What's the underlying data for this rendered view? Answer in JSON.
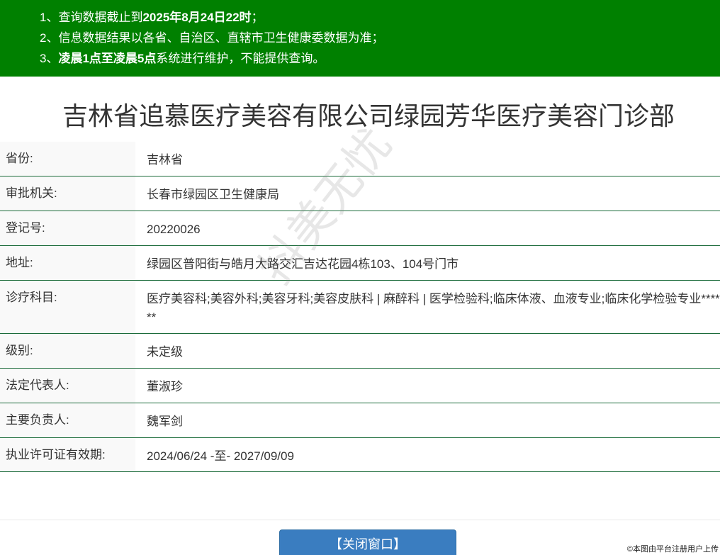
{
  "notice": {
    "line1_prefix": "1、查询数据截止到",
    "line1_bold": "2025年8月24日22时",
    "line1_suffix": "；",
    "line2": "2、信息数据结果以各省、自治区、直辖市卫生健康委数据为准；",
    "line3_prefix": "3、",
    "line3_bold": "凌晨1点至凌晨5点",
    "line3_suffix": "系统进行维护，不能提供查询。"
  },
  "title": "吉林省追慕医疗美容有限公司绿园芳华医疗美容门诊部",
  "rows": [
    {
      "label": "省份:",
      "value": "吉林省"
    },
    {
      "label": "审批机关:",
      "value": "长春市绿园区卫生健康局"
    },
    {
      "label": "登记号:",
      "value": "20220026"
    },
    {
      "label": "地址:",
      "value": "绿园区普阳街与皓月大路交汇吉达花园4栋103、104号门市"
    },
    {
      "label": "诊疗科目:",
      "value": "医疗美容科;美容外科;美容牙科;美容皮肤科 | 麻醉科 | 医学检验科;临床体液、血液专业;临床化学检验专业******"
    },
    {
      "label": "级别:",
      "value": "未定级"
    },
    {
      "label": "法定代表人:",
      "value": "董淑珍"
    },
    {
      "label": "主要负责人:",
      "value": "魏军剑"
    },
    {
      "label": "执业许可证有效期:",
      "value": "2024/06/24 -至- 2027/09/09"
    }
  ],
  "watermark": "抖美无忧",
  "close_button": "【关闭窗口】",
  "footer_note": "©本图由平台注册用户上传",
  "colors": {
    "notice_bg": "#008000",
    "divider": "#1b6b3a",
    "button_bg": "#3a7dc0"
  }
}
